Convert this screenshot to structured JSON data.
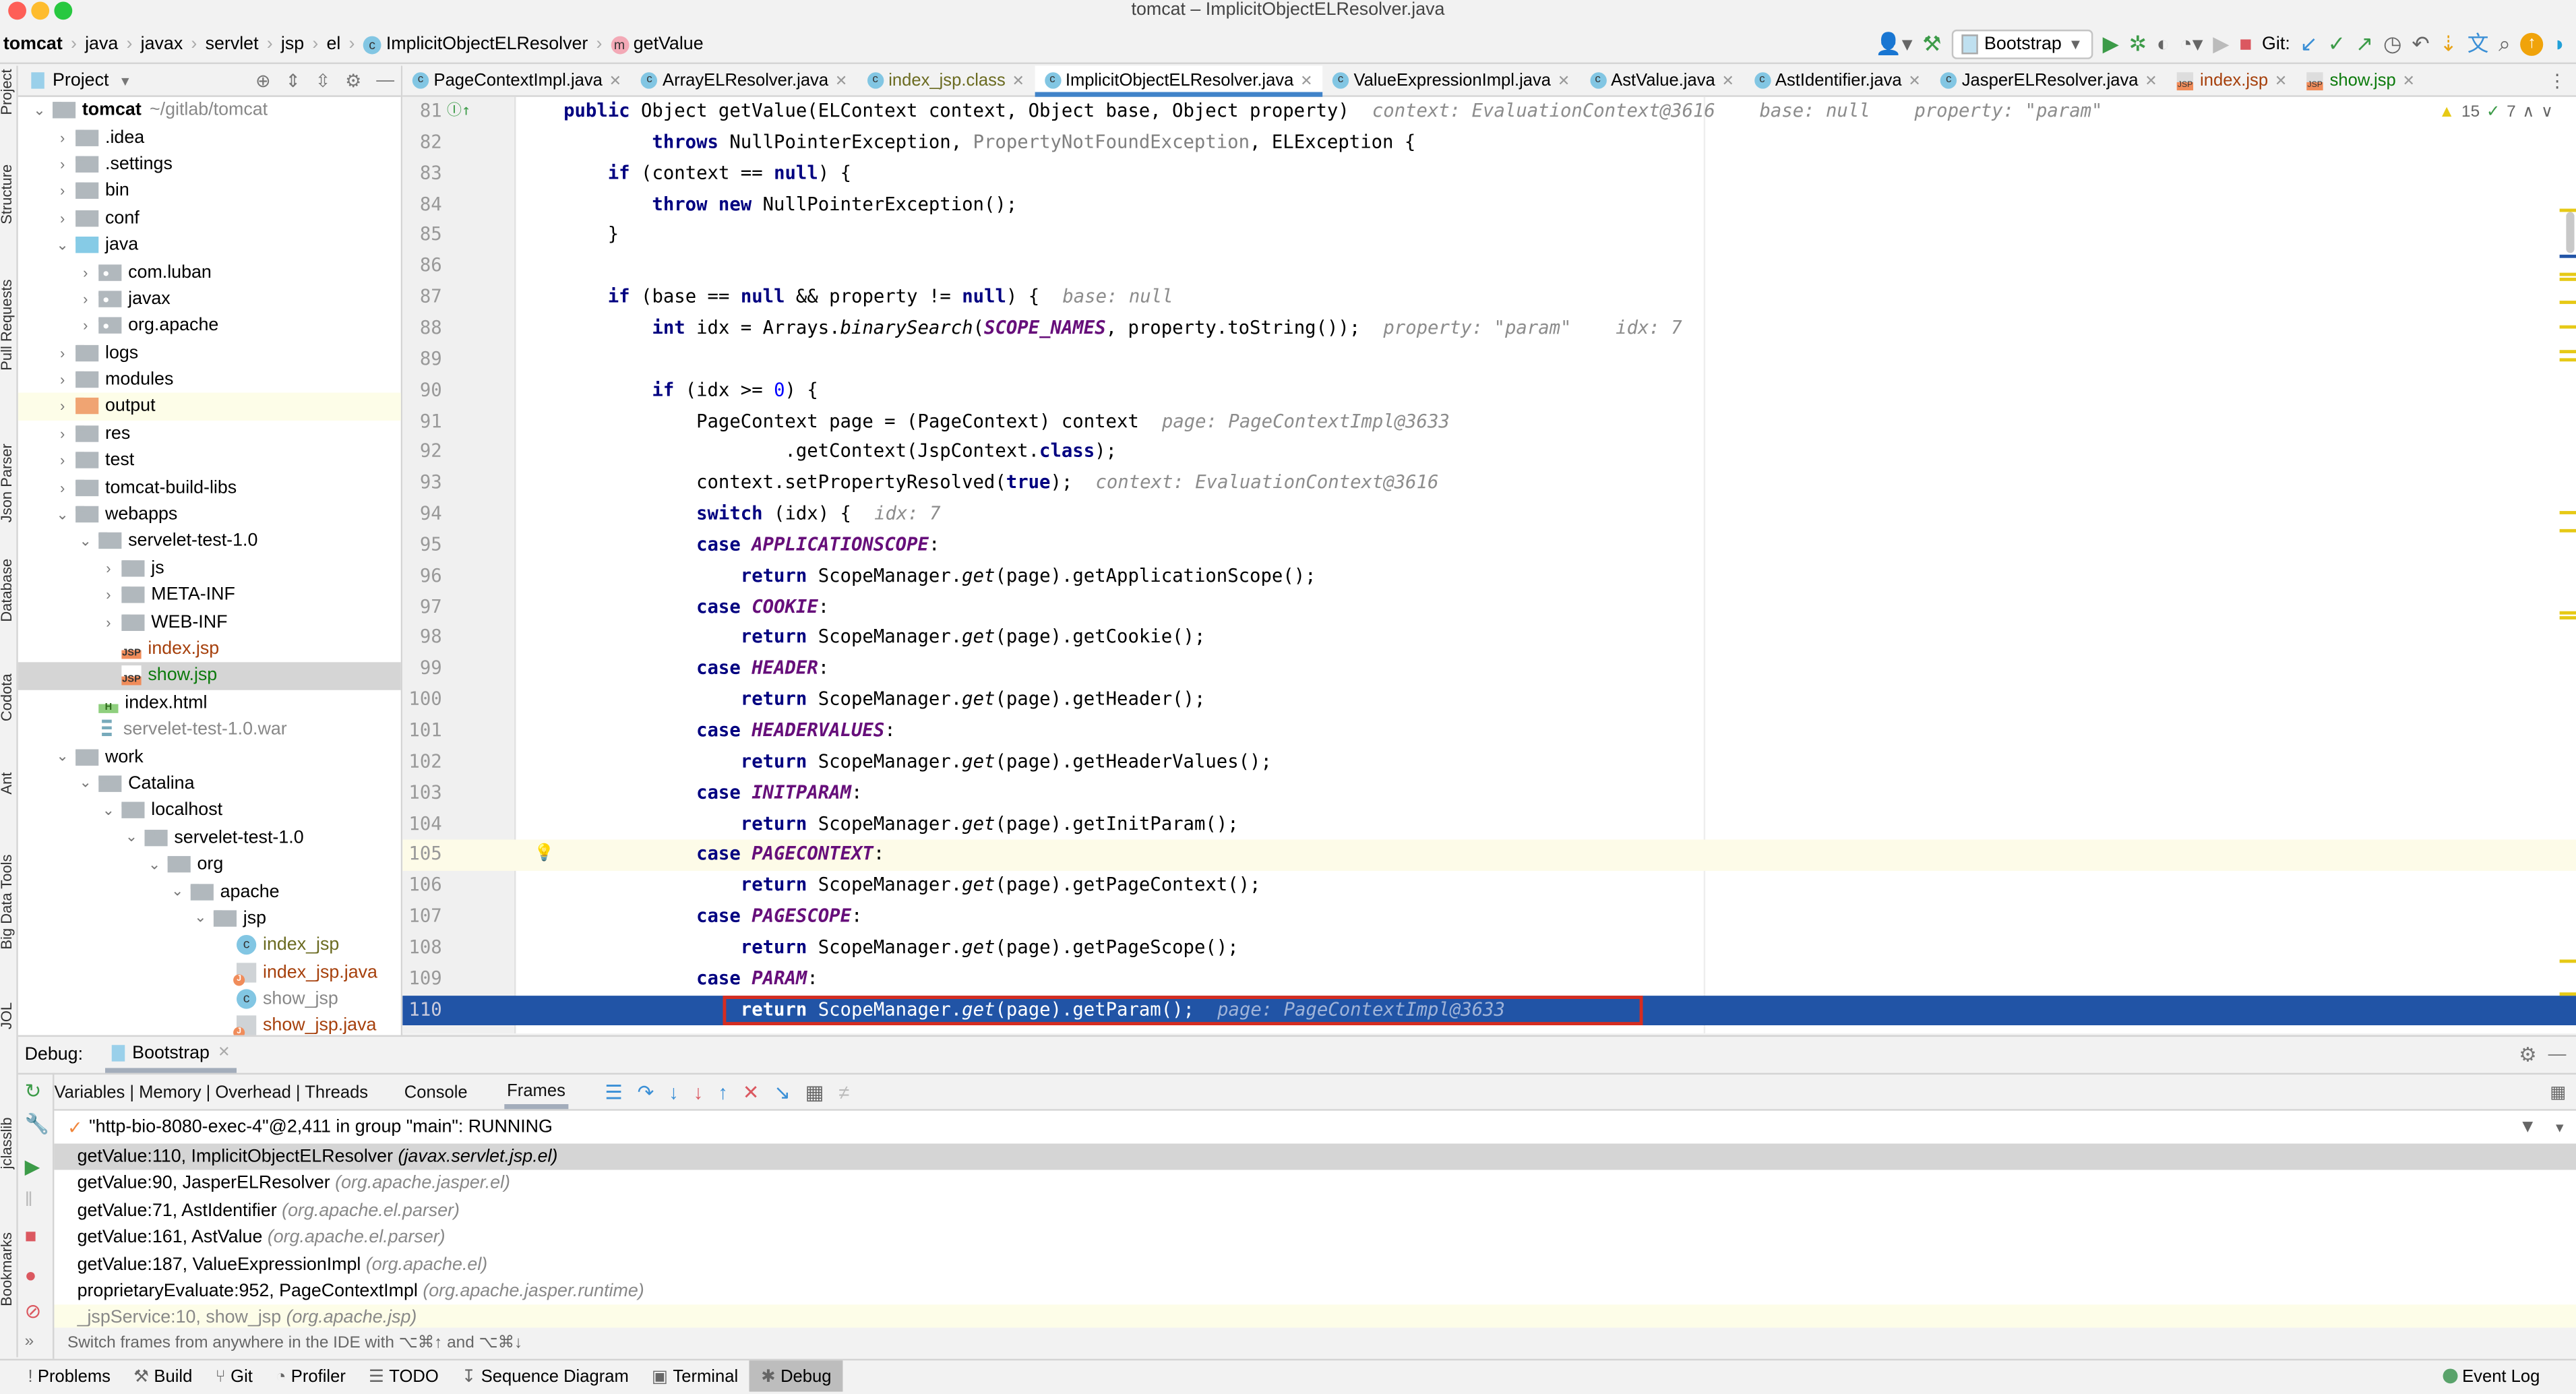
{
  "window": {
    "title": "tomcat – ImplicitObjectELResolver.java"
  },
  "breadcrumb": [
    "tomcat",
    "java",
    "javax",
    "servlet",
    "jsp",
    "el",
    "ImplicitObjectELResolver",
    "getValue"
  ],
  "toolbar": {
    "run_config": "Bootstrap",
    "git_label": "Git:",
    "colors": {
      "run": "#3c9b48",
      "stop": "#db5860",
      "accent": "#4083c9"
    }
  },
  "left_strip": [
    "Project",
    "Structure",
    "Pull Requests",
    "Json Parser",
    "Database",
    "Codota",
    "Ant",
    "Big Data Tools",
    "JOL"
  ],
  "left_strip_lower": [
    "jclasslib",
    "Bookmarks"
  ],
  "project": {
    "header": "Project",
    "tree": [
      {
        "label": "tomcat",
        "extra": "~/gitlab/tomcat",
        "depth": 0,
        "arrow": "down",
        "icon": "module"
      },
      {
        "label": ".idea",
        "depth": 1,
        "arrow": "right",
        "icon": "gray"
      },
      {
        "label": ".settings",
        "depth": 1,
        "arrow": "right",
        "icon": "gray"
      },
      {
        "label": "bin",
        "depth": 1,
        "arrow": "right",
        "icon": "gray"
      },
      {
        "label": "conf",
        "depth": 1,
        "arrow": "right",
        "icon": "gray"
      },
      {
        "label": "java",
        "depth": 1,
        "arrow": "down",
        "icon": "blue"
      },
      {
        "label": "com.luban",
        "depth": 2,
        "arrow": "right",
        "icon": "pkg"
      },
      {
        "label": "javax",
        "depth": 2,
        "arrow": "right",
        "icon": "pkg"
      },
      {
        "label": "org.apache",
        "depth": 2,
        "arrow": "right",
        "icon": "pkg"
      },
      {
        "label": "logs",
        "depth": 1,
        "arrow": "right",
        "icon": "gray"
      },
      {
        "label": "modules",
        "depth": 1,
        "arrow": "right",
        "icon": "gray"
      },
      {
        "label": "output",
        "depth": 1,
        "arrow": "right",
        "icon": "orange",
        "state": "hl"
      },
      {
        "label": "res",
        "depth": 1,
        "arrow": "right",
        "icon": "gray"
      },
      {
        "label": "test",
        "depth": 1,
        "arrow": "right",
        "icon": "gray"
      },
      {
        "label": "tomcat-build-libs",
        "depth": 1,
        "arrow": "right",
        "icon": "gray"
      },
      {
        "label": "webapps",
        "depth": 1,
        "arrow": "down",
        "icon": "gray"
      },
      {
        "label": "servelet-test-1.0",
        "depth": 2,
        "arrow": "down",
        "icon": "gray"
      },
      {
        "label": "js",
        "depth": 3,
        "arrow": "right",
        "icon": "gray"
      },
      {
        "label": "META-INF",
        "depth": 3,
        "arrow": "right",
        "icon": "gray"
      },
      {
        "label": "WEB-INF",
        "depth": 3,
        "arrow": "right",
        "icon": "gray"
      },
      {
        "label": "index.jsp",
        "depth": 3,
        "arrow": "",
        "icon": "jsp",
        "color": "#a6400c"
      },
      {
        "label": "show.jsp",
        "depth": 3,
        "arrow": "",
        "icon": "jsp",
        "color": "#0c7a0c",
        "state": "sel"
      },
      {
        "label": "index.html",
        "depth": 2,
        "arrow": "",
        "icon": "html"
      },
      {
        "label": "servelet-test-1.0.war",
        "depth": 2,
        "arrow": "",
        "icon": "war",
        "color": "#888888"
      },
      {
        "label": "work",
        "depth": 1,
        "arrow": "down",
        "icon": "gray"
      },
      {
        "label": "Catalina",
        "depth": 2,
        "arrow": "down",
        "icon": "gray"
      },
      {
        "label": "localhost",
        "depth": 3,
        "arrow": "down",
        "icon": "gray"
      },
      {
        "label": "servelet-test-1.0",
        "depth": 4,
        "arrow": "down",
        "icon": "gray"
      },
      {
        "label": "org",
        "depth": 5,
        "arrow": "down",
        "icon": "gray"
      },
      {
        "label": "apache",
        "depth": 6,
        "arrow": "down",
        "icon": "gray"
      },
      {
        "label": "jsp",
        "depth": 7,
        "arrow": "down",
        "icon": "gray"
      },
      {
        "label": "index_jsp",
        "depth": 8,
        "arrow": "",
        "icon": "cls",
        "color": "#6b6b21"
      },
      {
        "label": "index_jsp.java",
        "depth": 8,
        "arrow": "",
        "icon": "java",
        "color": "#a6400c"
      },
      {
        "label": "show_jsp",
        "depth": 8,
        "arrow": "",
        "icon": "cls",
        "color": "#888888"
      },
      {
        "label": "show_jsp.java",
        "depth": 8,
        "arrow": "",
        "icon": "java",
        "color": "#a6400c"
      }
    ]
  },
  "tabs": [
    {
      "label": "PageContextImpl.java",
      "icon": "c"
    },
    {
      "label": "ArrayELResolver.java",
      "icon": "c"
    },
    {
      "label": "index_jsp.class",
      "icon": "c",
      "color": "#6b6b21"
    },
    {
      "label": "ImplicitObjectELResolver.java",
      "icon": "c",
      "active": true
    },
    {
      "label": "ValueExpressionImpl.java",
      "icon": "c"
    },
    {
      "label": "AstValue.java",
      "icon": "c"
    },
    {
      "label": "AstIdentifier.java",
      "icon": "c"
    },
    {
      "label": "JasperELResolver.java",
      "icon": "c"
    },
    {
      "label": "index.jsp",
      "icon": "jsp",
      "color": "#a6400c"
    },
    {
      "label": "show.jsp",
      "icon": "jsp",
      "color": "#0c7a0c"
    }
  ],
  "editor": {
    "inspections": {
      "warnings": "15",
      "ok": "7"
    },
    "lines": [
      {
        "n": "81",
        "html": "<span class='kw'>public</span> Object getValue(ELContext context, Object base, Object property)<span class='hint'>context: EvaluationContext@3616    base: null    property: \"param\"</span>"
      },
      {
        "n": "82",
        "html": "        <span class='kw'>throws</span> NullPointerException, <span class='gr'>PropertyNotFoundException</span>, ELException {"
      },
      {
        "n": "83",
        "html": "    <span class='kw'>if</span> (context == <span class='kw'>null</span>) {"
      },
      {
        "n": "84",
        "html": "        <span class='kw'>throw new</span> NullPointerException();"
      },
      {
        "n": "85",
        "html": "    }"
      },
      {
        "n": "86",
        "html": ""
      },
      {
        "n": "87",
        "html": "    <span class='kw'>if</span> (base == <span class='kw'>null</span> &amp;&amp; property != <span class='kw'>null</span>) {<span class='hint'>base: null</span>"
      },
      {
        "n": "88",
        "html": "        <span class='kw'>int</span> idx = Arrays.<span class='it'>binarySearch</span>(<span class='st'>SCOPE_NAMES</span>, property.toString());<span class='hint'>property: \"param\"    idx: 7</span>"
      },
      {
        "n": "89",
        "html": ""
      },
      {
        "n": "90",
        "html": "        <span class='kw'>if</span> (idx &gt;= <span class='num'>0</span>) {"
      },
      {
        "n": "91",
        "html": "            PageContext page = (PageContext) context<span class='hint'>page: PageContextImpl@3633</span>"
      },
      {
        "n": "92",
        "html": "                    .getContext(JspContext.<span class='kw'>class</span>);"
      },
      {
        "n": "93",
        "html": "            context.setPropertyResolved(<span class='kw'>true</span>);<span class='hint'>context: EvaluationContext@3616</span>"
      },
      {
        "n": "94",
        "html": "            <span class='kw'>switch</span> (idx) {<span class='hint'>idx: 7</span>"
      },
      {
        "n": "95",
        "html": "            <span class='kw'>case</span> <span class='st'>APPLICATIONSCOPE</span>:"
      },
      {
        "n": "96",
        "html": "                <span class='kw'>return</span> ScopeManager.<span class='it'>get</span>(page).getApplicationScope();"
      },
      {
        "n": "97",
        "html": "            <span class='kw'>case</span> <span class='st'>COOKIE</span>:"
      },
      {
        "n": "98",
        "html": "                <span class='kw'>return</span> ScopeManager.<span class='it'>get</span>(page).getCookie();"
      },
      {
        "n": "99",
        "html": "            <span class='kw'>case</span> <span class='st'>HEADER</span>:"
      },
      {
        "n": "100",
        "html": "                <span class='kw'>return</span> ScopeManager.<span class='it'>get</span>(page).getHeader();"
      },
      {
        "n": "101",
        "html": "            <span class='kw'>case</span> <span class='st'>HEADERVALUES</span>:"
      },
      {
        "n": "102",
        "html": "                <span class='kw'>return</span> ScopeManager.<span class='it'>get</span>(page).getHeaderValues();"
      },
      {
        "n": "103",
        "html": "            <span class='kw'>case</span> <span class='st'>INITPARAM</span>:"
      },
      {
        "n": "104",
        "html": "                <span class='kw'>return</span> ScopeManager.<span class='it'>get</span>(page).getInitParam();"
      },
      {
        "n": "105",
        "html": "            <span class='kw'>case</span> <span class='st'>PAGECONTEXT</span>:",
        "state": "cur"
      },
      {
        "n": "106",
        "html": "                <span class='kw'>return</span> ScopeManager.<span class='it'>get</span>(page).getPageContext();"
      },
      {
        "n": "107",
        "html": "            <span class='kw'>case</span> <span class='st'>PAGESCOPE</span>:"
      },
      {
        "n": "108",
        "html": "                <span class='kw'>return</span> ScopeManager.<span class='it'>get</span>(page).getPageScope();"
      },
      {
        "n": "109",
        "html": "            <span class='kw'>case</span> <span class='st'>PARAM</span>:"
      },
      {
        "n": "110",
        "html": "                <span class='kw'>return</span> ScopeManager.<span class='it'>get</span>(page).getParam();<span class='hint'>page: PageContextImpl@3633</span>",
        "state": "exec"
      }
    ]
  },
  "debug": {
    "label": "Debug:",
    "session_tab": "Bootstrap",
    "tabs": [
      "Variables | Memory | Overhead | Threads",
      "Console",
      "Frames"
    ],
    "active_tab": "Frames",
    "thread": "\"http-bio-8080-exec-4\"@2,411 in group \"main\": RUNNING",
    "frames": [
      {
        "method": "getValue:110, ImplicitObjectELResolver",
        "pkg": "(javax.servlet.jsp.el)",
        "state": "sel"
      },
      {
        "method": "getValue:90, JasperELResolver",
        "pkg": "(org.apache.jasper.el)"
      },
      {
        "method": "getValue:71, AstIdentifier",
        "pkg": "(org.apache.el.parser)"
      },
      {
        "method": "getValue:161, AstValue",
        "pkg": "(org.apache.el.parser)"
      },
      {
        "method": "getValue:187, ValueExpressionImpl",
        "pkg": "(org.apache.el)"
      },
      {
        "method": "proprietaryEvaluate:952, PageContextImpl",
        "pkg": "(org.apache.jasper.runtime)"
      },
      {
        "method": "_jspService:10, show_jsp",
        "pkg": "(org.apache.jsp)",
        "state": "lib"
      }
    ],
    "tip": "Switch frames from anywhere in the IDE with ⌥⌘↑ and ⌥⌘↓"
  },
  "bottom_bar": {
    "items": [
      "Problems",
      "Build",
      "Git",
      "Profiler",
      "TODO",
      "Sequence Diagram",
      "Terminal",
      "Debug"
    ],
    "icons": [
      "!",
      "⚒",
      "⑂",
      "◔",
      "☰",
      "↧",
      "▣",
      "✱"
    ],
    "active": "Debug",
    "event_log": "Event Log"
  }
}
